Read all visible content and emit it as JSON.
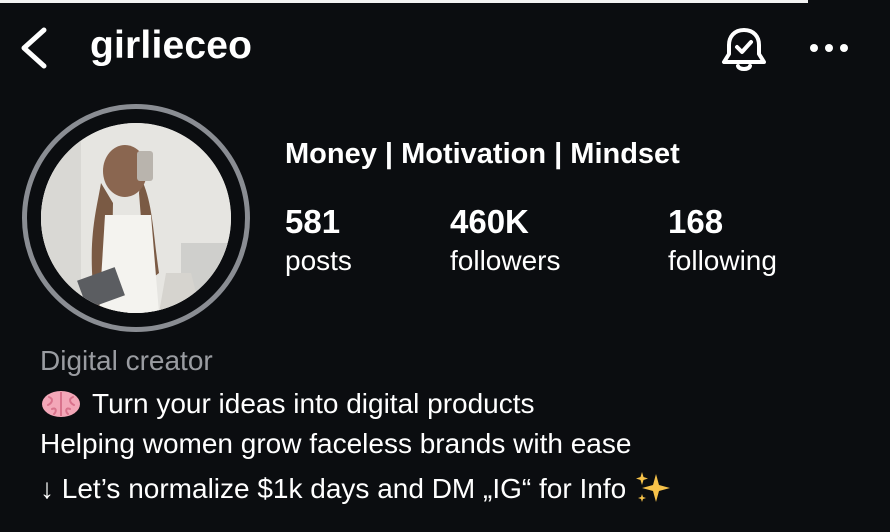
{
  "header": {
    "username": "girlieceo",
    "back_icon": "chevron-left-icon",
    "bell_icon": "bell-check-icon",
    "more_icon": "more-horizontal-icon"
  },
  "profile": {
    "headline": "Money | Motivation | Mindset",
    "stats": {
      "posts": {
        "value": "581",
        "label": "posts"
      },
      "followers": {
        "value": "460K",
        "label": "followers"
      },
      "following": {
        "value": "168",
        "label": "following"
      }
    },
    "category": "Digital creator",
    "bio": {
      "line1_icon": "brain-emoji",
      "line1": "Turn your ideas into digital products",
      "line2": "Helping women grow faceless brands with ease",
      "line3": "↓ Let’s normalize $1k days and DM „IG“ for Info",
      "line3_icon": "sparkles-emoji"
    }
  },
  "colors": {
    "background": "#0b0d10",
    "text": "#ffffff",
    "muted": "#9a9ca1",
    "avatar_ring": "#8a8d93"
  }
}
